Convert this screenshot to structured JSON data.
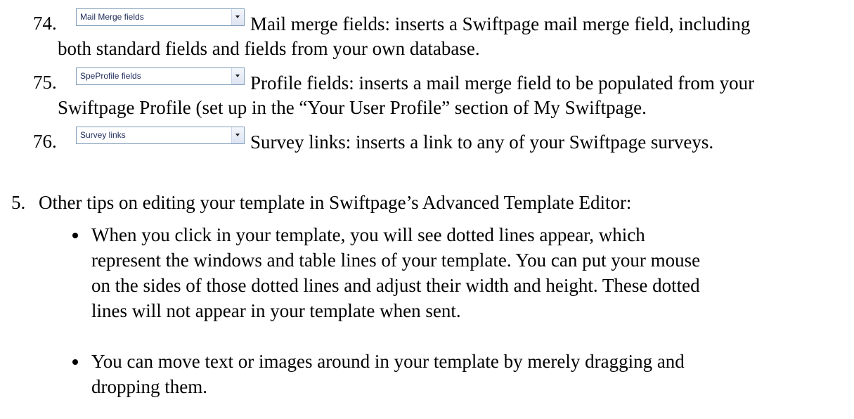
{
  "items": [
    {
      "number": "74.",
      "dropdown_value": "Mail Merge fields",
      "line1": "Mail merge fields: inserts a Swiftpage mail merge field, including",
      "line2": "both standard fields and fields from your own database."
    },
    {
      "number": "75.",
      "dropdown_value": "SpeProfile fields",
      "line1": "Profile fields: inserts a mail merge field to be populated from your",
      "line2": "Swiftpage Profile (set up in the “Your User Profile” section of My Swiftpage."
    },
    {
      "number": "76.",
      "dropdown_value": "Survey links",
      "line1": "Survey links: inserts a link to any of your Swiftpage surveys."
    }
  ],
  "section": {
    "number": "5.",
    "title": "Other tips on editing your template in Swiftpage’s Advanced Template Editor:",
    "bullets": [
      {
        "lines": [
          "When you click in your template, you will see dotted lines appear, which",
          "represent the windows and table lines of your template.  You can put your mouse",
          "on the sides of those dotted lines and adjust their width and height.  These dotted",
          "lines will not appear in your template when sent."
        ]
      },
      {
        "lines": [
          "You can move text or images around in your template by merely dragging and",
          "dropping them."
        ]
      }
    ]
  }
}
